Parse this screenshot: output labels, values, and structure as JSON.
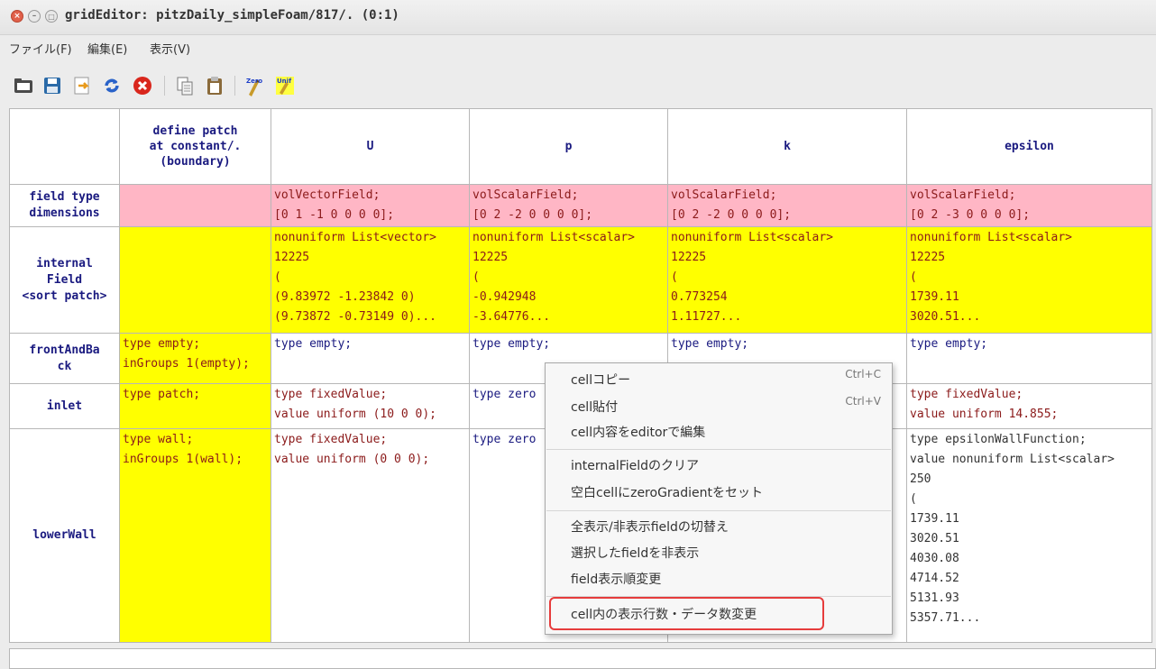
{
  "window": {
    "title": "gridEditor: pitzDaily_simpleFoam/817/. (0:1)"
  },
  "menubar": [
    "ファイル(F)",
    "編集(E)",
    "表示(V)"
  ],
  "toolbar": {
    "icons": [
      "folder-icon",
      "save-icon",
      "export-icon",
      "refresh-icon",
      "cancel-icon",
      "copy-icon",
      "paste-icon",
      "zero-icon",
      "unif-icon"
    ],
    "zero_label": "Zero",
    "unif_label": "Unif"
  },
  "grid": {
    "headers": [
      "define patch\nat constant/.\n(boundary)",
      "U",
      "p",
      "k",
      "epsilon"
    ],
    "rows": [
      {
        "header": "field type\ndimensions",
        "cells": [
          "",
          "volVectorField;\n[0 1 -1 0 0 0 0];",
          "volScalarField;\n[0 2 -2 0 0 0 0];",
          "volScalarField;\n[0 2 -2 0 0 0 0];",
          "volScalarField;\n[0 2 -3 0 0 0 0];"
        ]
      },
      {
        "header": "internal\nField\n<sort patch>",
        "cells": [
          "",
          "nonuniform List<vector>\n12225\n(\n(9.83972 -1.23842 0)\n(9.73872 -0.73149 0)...",
          "nonuniform List<scalar>\n12225\n(\n-0.942948\n-3.64776...",
          "nonuniform List<scalar>\n12225\n(\n0.773254\n1.11727...",
          "nonuniform List<scalar>\n12225\n(\n1739.11\n3020.51..."
        ]
      },
      {
        "header": "frontAndBa\nck",
        "cells": [
          "type empty;\ninGroups 1(empty);",
          "type empty;",
          "type empty;",
          "type empty;",
          "type empty;"
        ]
      },
      {
        "header": "inlet",
        "cells": [
          "type patch;",
          "type fixedValue;\nvalue uniform (10 0 0);",
          "type zero",
          "",
          "type fixedValue;\nvalue uniform 14.855;"
        ]
      },
      {
        "header": "lowerWall",
        "cells": [
          "type wall;\ninGroups 1(wall);",
          "type fixedValue;\nvalue uniform (0 0 0);",
          "type zero",
          "",
          "type epsilonWallFunction;\nvalue nonuniform List<scalar>\n250\n(\n1739.11\n3020.51\n4030.08\n4714.52\n5131.93\n5357.71..."
        ]
      }
    ]
  },
  "context_menu": {
    "items": [
      {
        "label": "cellコピー",
        "shortcut": "Ctrl+C"
      },
      {
        "label": "cell貼付",
        "shortcut": "Ctrl+V"
      },
      {
        "label": "cell内容をeditorで編集",
        "shortcut": ""
      },
      {
        "label": "internalFieldのクリア",
        "shortcut": ""
      },
      {
        "label": "空白cellにzeroGradientをセット",
        "shortcut": ""
      },
      {
        "label": "全表示/非表示fieldの切替え",
        "shortcut": ""
      },
      {
        "label": "選択したfieldを非表示",
        "shortcut": ""
      },
      {
        "label": "field表示順変更",
        "shortcut": ""
      },
      {
        "label": "cell内の表示行数・データ数変更",
        "shortcut": ""
      }
    ],
    "highlighted": "cell内の表示行数・データ数変更",
    "highlight_color": "#e63c3c"
  },
  "colors": {
    "pink_cell": "#ffb6c5",
    "yellow_cell": "#ffff00",
    "header_text": "#1a1a80",
    "value_text": "#8b1a1a"
  }
}
